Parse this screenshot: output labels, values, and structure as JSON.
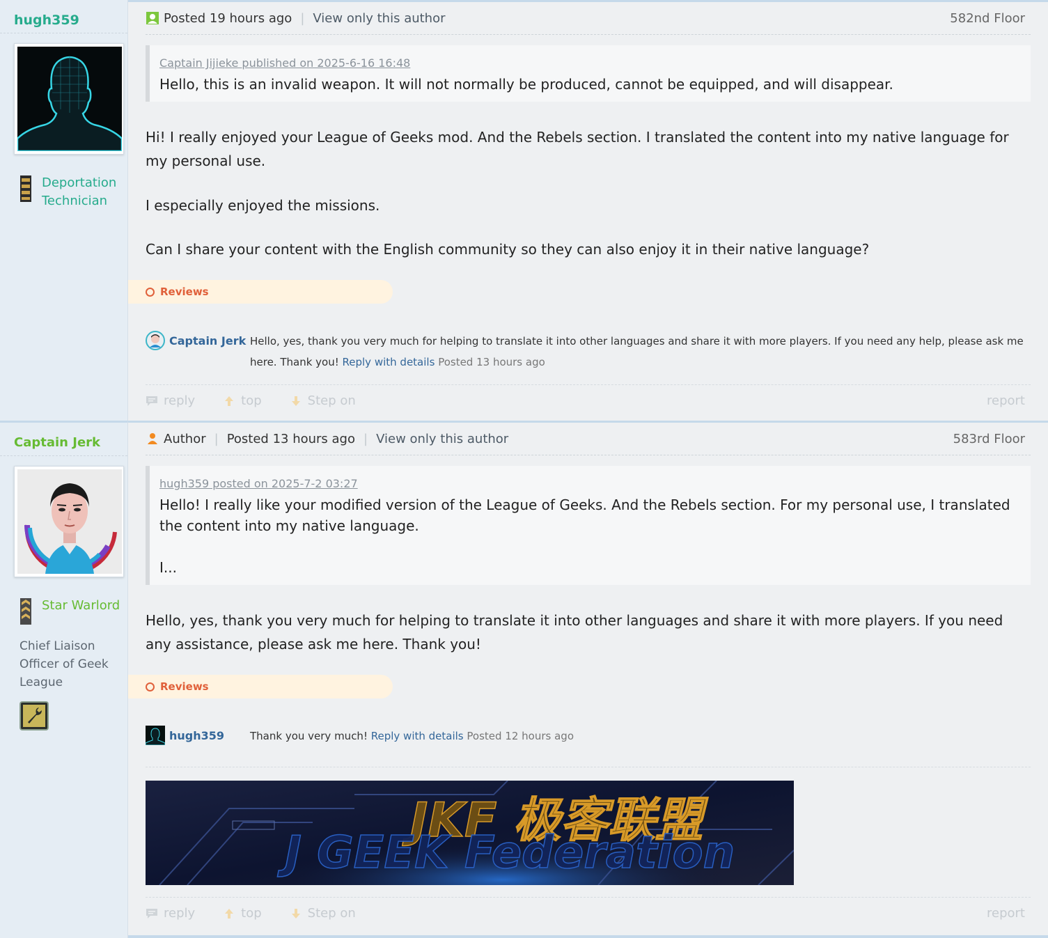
{
  "posts": [
    {
      "author": {
        "name": "hugh359",
        "rank_title": "Deportation Technician"
      },
      "header": {
        "posted": "Posted 19 hours ago",
        "view_only": "View only this author",
        "floor": "582nd Floor"
      },
      "quote": {
        "head": "Captain Jijieke published on 2025-6-16 16:48",
        "body": "Hello, this is an invalid weapon. It will not normally be produced, cannot be equipped, and will disappear."
      },
      "paragraphs": [
        "Hi! I really enjoyed your League of Geeks mod. And the Rebels section. I translated the content into my native language for my personal use.",
        "I especially enjoyed the missions.",
        "Can I share your content with the English community so they can also enjoy it in their native language?"
      ],
      "reviews_label": "Reviews",
      "comment": {
        "user": "Captain Jerk",
        "text": "Hello, yes, thank you very much for helping to translate it into other languages and share it with more players. If you need any help, please ask me here. Thank you!",
        "reply_link": "Reply with details",
        "time": "Posted 13 hours ago"
      },
      "footer": {
        "reply": "reply",
        "top": "top",
        "step_on": "Step on",
        "report": "report"
      }
    },
    {
      "author": {
        "name": "Captain Jerk",
        "rank_title": "Star Warlord",
        "custom_title": "Chief Liaison Officer of Geek League"
      },
      "header": {
        "author_tag": "Author",
        "posted": "Posted 13 hours ago",
        "view_only": "View only this author",
        "floor": "583rd Floor"
      },
      "quote": {
        "head": "hugh359 posted on 2025-7-2 03:27",
        "body": "Hello! I really like your modified version of the League of Geeks. And the Rebels section. For my personal use, I translated the content into my native language.",
        "ellipsis": "I..."
      },
      "paragraphs": [
        "Hello, yes, thank you very much for helping to translate it into other languages and share it with more players. If you need any assistance, please ask me here. Thank you!"
      ],
      "reviews_label": "Reviews",
      "comment": {
        "user": "hugh359",
        "text": "Thank you very much!",
        "reply_link": "Reply with details",
        "time": "Posted 12 hours ago"
      },
      "banner": {
        "title_cn": "JKF 极客联盟",
        "title_en": "J GEEK Federation"
      },
      "footer": {
        "reply": "reply",
        "top": "top",
        "step_on": "Step on",
        "report": "report"
      }
    }
  ]
}
